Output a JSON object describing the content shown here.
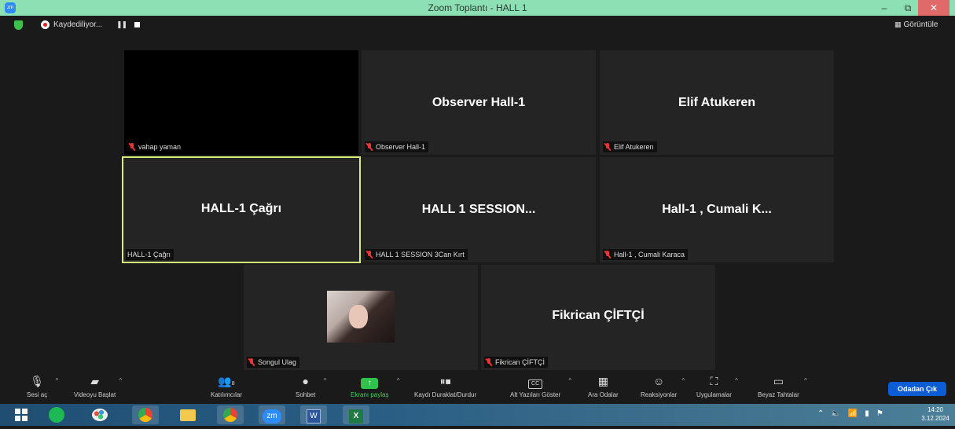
{
  "window": {
    "title": "Zoom Toplantı - HALL 1",
    "app_icon": "zoom",
    "controls": {
      "minimize": "–",
      "maximize": "⧉",
      "close": "✕"
    }
  },
  "recording": {
    "status_label": "Kaydediliyor...",
    "pause_icon": "❚❚",
    "view_label": "Görüntüle",
    "view_icon": "grid-icon"
  },
  "tiles": [
    {
      "big_name": "",
      "tag": "vahap yaman",
      "muted": true,
      "style": "black"
    },
    {
      "big_name": "Observer Hall-1",
      "tag": "Observer Hall-1",
      "muted": true
    },
    {
      "big_name": "Elif Atukeren",
      "tag": "Elif Atukeren",
      "muted": true
    },
    {
      "big_name": "HALL-1 Çağrı",
      "tag": "HALL-1 Çağrı",
      "muted": false,
      "active": true
    },
    {
      "big_name": "HALL 1 SESSION...",
      "tag": "HALL 1 SESSION 3Can Kırt",
      "muted": true
    },
    {
      "big_name": "Hall-1 , Cumali K...",
      "tag": "Hall-1 , Cumali Karaca",
      "muted": true
    },
    {
      "big_name": "",
      "tag": "Songul Ulag",
      "muted": true,
      "has_photo": true
    },
    {
      "big_name": "Fikrican ÇİFTÇİ",
      "tag": "Fikrican ÇİFTÇİ",
      "muted": true
    }
  ],
  "toolbar": {
    "audio": "Sesi aç",
    "video": "Videoyu Başlat",
    "participants": "Katılımcılar",
    "participants_count": "8",
    "chat": "Sohbet",
    "share": "Ekranı paylaş",
    "record": "Kaydı Duraklat/Durdur",
    "captions": "Alt Yazıları Göster",
    "breakout": "Ara Odalar",
    "reactions": "Reaksiyonlar",
    "apps": "Uygulamalar",
    "whiteboard": "Beyaz Tahtalar",
    "leave": "Odadan Çık",
    "captions_icon": "CC"
  },
  "taskbar": {
    "apps": [
      "windows-start",
      "spotify",
      "paint",
      "chrome",
      "file-explorer",
      "chrome",
      "zoom",
      "word",
      "excel"
    ],
    "zoom_label": "zm",
    "excel_label": "X",
    "word_label": "W",
    "clock_time": "14:20",
    "clock_date": "3.12.2024"
  },
  "colors": {
    "titlebar": "#8de0b4",
    "tile_bg": "#242424",
    "active_speaker": "#d8ef77",
    "mute_red": "#e33333",
    "share_green": "#2fc24d",
    "leave_blue": "#0b5cd5"
  }
}
